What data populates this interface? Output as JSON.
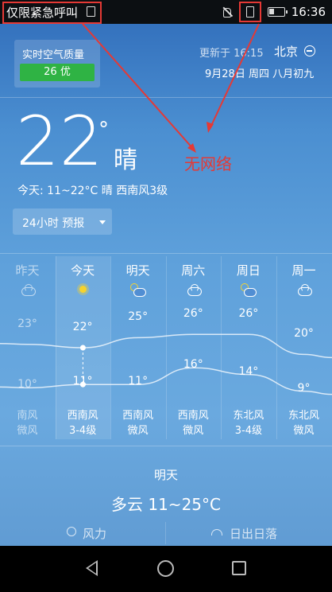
{
  "status_bar": {
    "carrier": "仅限紧急呼叫",
    "time": "16:36"
  },
  "annotation": {
    "label": "无网络",
    "color": "#e53935"
  },
  "air_quality": {
    "title": "实时空气质量",
    "value": "26 优",
    "color": "#2fb344"
  },
  "header": {
    "updated": "更新于 16:15",
    "city": "北京",
    "date": "9月28日 周四 八月初九"
  },
  "current": {
    "temp": "22",
    "degree": "°",
    "condition": "晴",
    "today": "今天:  11~22°C  晴 西南风3级"
  },
  "forecast_button": {
    "label": "24小时 预报"
  },
  "chart_data": {
    "type": "line",
    "categories": [
      "昨天",
      "今天",
      "明天",
      "周六",
      "周日",
      "周一"
    ],
    "series": [
      {
        "values": [
          23,
          22,
          25,
          26,
          26,
          20
        ]
      },
      {
        "values": [
          10,
          11,
          11,
          16,
          14,
          9
        ]
      }
    ]
  },
  "forecast": {
    "days": [
      {
        "day": "昨天",
        "icon": "cloud-icon",
        "hi": "23°",
        "lo": "10°",
        "wind": "南风",
        "level": "微风"
      },
      {
        "day": "今天",
        "icon": "sun-icon",
        "hi": "22°",
        "lo": "11°",
        "wind": "西南风",
        "level": "3-4级"
      },
      {
        "day": "明天",
        "icon": "partly-cloudy-icon",
        "hi": "25°",
        "lo": "11°",
        "wind": "西南风",
        "level": "微风"
      },
      {
        "day": "周六",
        "icon": "cloud-icon",
        "hi": "26°",
        "lo": "16°",
        "wind": "西南风",
        "level": "微风"
      },
      {
        "day": "周日",
        "icon": "partly-cloudy-icon",
        "hi": "26°",
        "lo": "14°",
        "wind": "东北风",
        "level": "3-4级"
      },
      {
        "day": "周一",
        "icon": "cloud-icon",
        "hi": "20°",
        "lo": "9°",
        "wind": "东北风",
        "level": "微风"
      }
    ]
  },
  "tomorrow": {
    "title": "明天",
    "condition": "多云  11~25°C"
  },
  "tabs": {
    "wind": "风力",
    "sun": "日出日落"
  }
}
